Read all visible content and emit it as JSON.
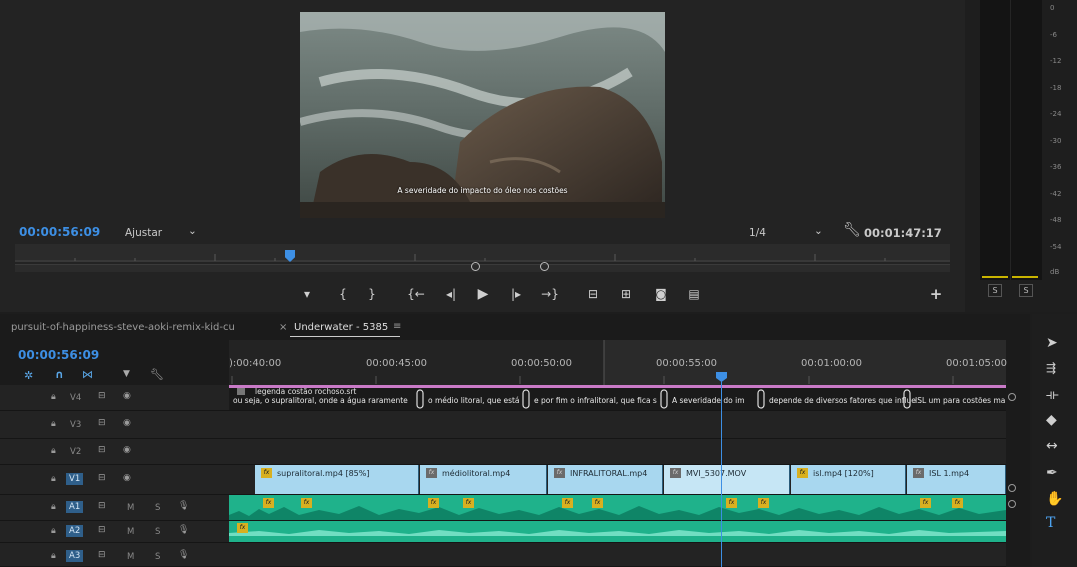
{
  "monitor": {
    "subtitle_text": "A severidade do impacto do óleo nos costões",
    "current_timecode": "00:00:56:09",
    "fit_label": "Ajustar",
    "resolution": "1/4",
    "duration_timecode": "00:01:47:17"
  },
  "meter": {
    "ticks": [
      "0",
      "-6",
      "-12",
      "-18",
      "-24",
      "-30",
      "-36",
      "-42",
      "-48",
      "-54",
      "dB"
    ],
    "solo_left": "S",
    "solo_right": "S"
  },
  "timeline": {
    "tabs": [
      {
        "label": "pursuit-of-happiness-steve-aoki-remix-kid-cu"
      },
      {
        "label": "Underwater - 5385"
      }
    ],
    "tab_close": "×",
    "tab_menu": "≡",
    "timecode": "00:00:56:09",
    "ruler_labels": [
      "):00:40:00",
      "00:00:45:00",
      "00:00:50:00",
      "00:00:55:00",
      "00:01:00:00",
      "00:01:05:00"
    ],
    "tracks": {
      "V4": "V4",
      "V3": "V3",
      "V2": "V2",
      "V1": "V1",
      "A1": "A1",
      "A2": "A2",
      "A3": "A3",
      "mute": "M",
      "solo": "S"
    },
    "subtitle_track": {
      "name": "legenda costão rochoso.srt",
      "segments": [
        "ou seja, o supralitoral, onde a água raramente",
        "o médio litoral, que está",
        "e por fim o infralitoral, que fica s",
        "A severidade do im",
        "depende de diversos fatores que influe",
        "ISL um para costões ma"
      ]
    },
    "video_clips": [
      "supralitoral.mp4 [85%]",
      "médiolitoral.mp4",
      "INFRALITORAL.mp4",
      "MVI_5307.MOV",
      "isl.mp4 [120%]",
      "ISL 1.mp4"
    ],
    "fx_label": "fx"
  },
  "colors": {
    "timecode_blue": "#3d8fe4",
    "video_clip": "#a8d7ef",
    "audio_clip": "#1fb28b",
    "subtitle_track": "#c97ac7"
  }
}
